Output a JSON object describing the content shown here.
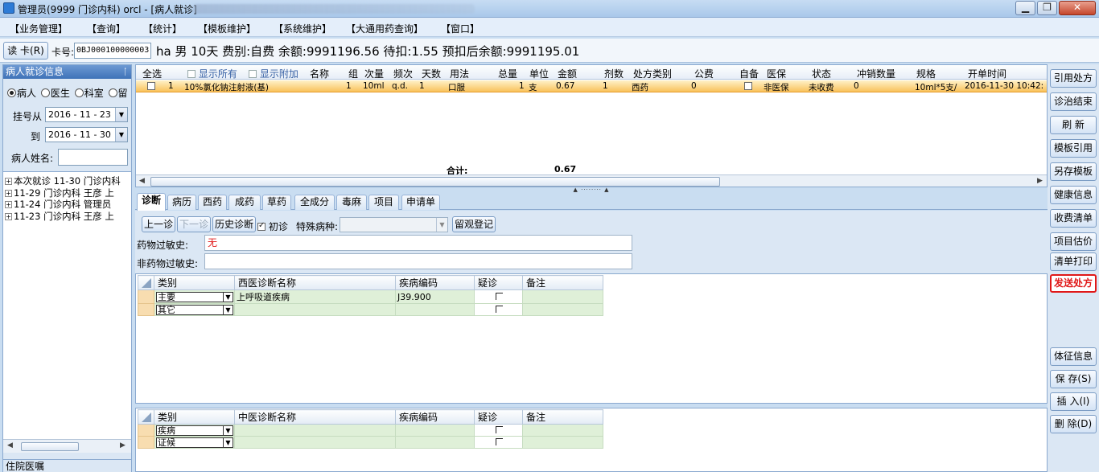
{
  "window": {
    "title": "管理员(9999 门诊内科) orcl - [病人就诊]",
    "controls": {
      "minimize": "▁",
      "restore": "❐",
      "close": "✕"
    }
  },
  "menu": [
    "【业务管理】",
    "【查询】",
    "【统计】",
    "【模板维护】",
    "【系统维护】",
    "【大通用药查询】",
    "【窗口】"
  ],
  "infobar": {
    "read_card": "读 卡(R)",
    "card_label": "卡号:",
    "card_no": "0BJ000100000003",
    "summary": "ha 男 10天 费别:自费 余额:9991196.56 待扣:1.55 预扣后余额:9991195.01"
  },
  "left": {
    "title": "病人就诊信息",
    "pin": "ᛙ",
    "radios": [
      "病人",
      "医生",
      "科室",
      "留"
    ],
    "reg_from_label": "挂号从",
    "reg_from": "2016 - 11 - 23",
    "reg_to_label": "到",
    "reg_to": "2016 - 11 - 30",
    "name_label": "病人姓名:",
    "tree": [
      "本次就诊 11-30 门诊内科",
      "11-29 门诊内科 王彦 上",
      "11-24 门诊内科 管理员",
      "11-23 门诊内科 王彦 上"
    ],
    "bottom": "住院医嘱"
  },
  "rx": {
    "headers": {
      "select_all": "全选",
      "show_all": "显示所有",
      "show_extra": "显示附加",
      "name": "名称",
      "group": "组",
      "dose": "次量",
      "freq": "频次",
      "days": "天数",
      "usage": "用法",
      "total": "总量",
      "unit": "单位",
      "amount": "金额",
      "packs": "剂数",
      "rx_type": "处方类别",
      "public_fee": "公费",
      "self_prep": "自备",
      "insurance": "医保",
      "status": "状态",
      "offset_qty": "冲销数量",
      "spec": "规格",
      "start_time": "开单时间"
    },
    "rows": [
      {
        "group": "1",
        "name": "10%氯化钠注射液(基)",
        "group_no": "1",
        "dose": "10ml",
        "freq": "q.d.",
        "days": "1",
        "usage": "口服",
        "total": "1",
        "unit": "支",
        "amount": "0.67",
        "packs": "1",
        "rx_type": "西药",
        "public_fee": "0",
        "insurance": "非医保",
        "status": "未收费",
        "offset_qty": "0",
        "spec": "10ml*5支/",
        "start_time": "2016-11-30 10:42:"
      }
    ],
    "total_label": "合计:",
    "total_value": "0.67"
  },
  "tabs": [
    "诊断",
    "病历",
    "西药",
    "成药",
    "草药",
    "全成分",
    "毒麻",
    "项目",
    "申请单"
  ],
  "diagnosis": {
    "prev": "上一诊",
    "next": "下一诊",
    "history": "历史诊断",
    "first_visit": "初诊",
    "special_label": "特殊病种:",
    "observe": "留观登记",
    "drug_allergy_label": "药物过敏史:",
    "drug_allergy": "无",
    "nondrug_allergy_label": "非药物过敏史:",
    "nondrug_allergy": ""
  },
  "western_grid": {
    "headers": [
      "类别",
      "西医诊断名称",
      "疾病编码",
      "疑诊",
      "备注"
    ],
    "rows": [
      {
        "type": "主要",
        "name": "上呼吸道疾病",
        "code": "J39.900",
        "remark": ""
      },
      {
        "type": "其它",
        "name": "",
        "code": "",
        "remark": ""
      }
    ]
  },
  "tcm_grid": {
    "headers": [
      "类别",
      "中医诊断名称",
      "疾病编码",
      "疑诊",
      "备注"
    ],
    "rows": [
      {
        "type": "疾病",
        "name": "",
        "code": "",
        "remark": ""
      },
      {
        "type": "证候",
        "name": "",
        "code": "",
        "remark": ""
      }
    ]
  },
  "sidebar": [
    "引用处方",
    "诊治结束",
    "刷 新",
    "模板引用",
    "另存模板",
    "健康信息",
    "收费清单",
    "项目估价",
    "清单打印",
    "发送处方",
    "体征信息",
    "保 存(S)",
    "插 入(I)",
    "删 除(D)"
  ],
  "colors": {
    "send_button": "#e01818",
    "selected_row": "#f9c25a",
    "title_bar": "#3e72b8"
  }
}
